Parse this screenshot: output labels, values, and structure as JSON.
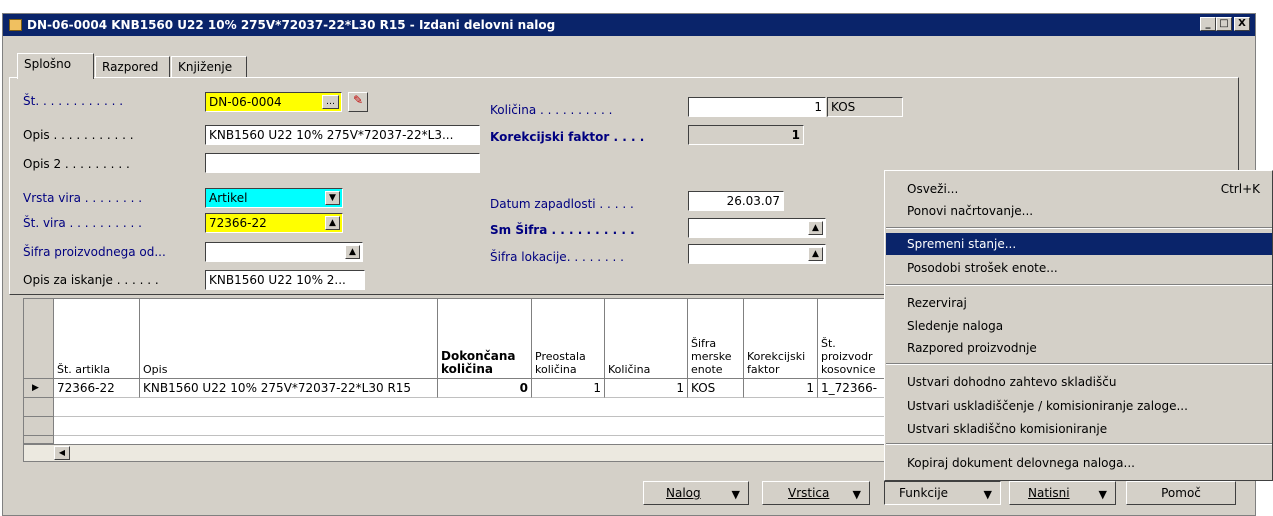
{
  "window": {
    "title": "DN-06-0004 KNB1560 U22 10% 275V*72037-22*L30 R15 - Izdani delovni nalog",
    "controls": [
      "_",
      "□",
      "X"
    ]
  },
  "tabs": [
    "Splošno",
    "Razpored",
    "Knjiženje"
  ],
  "form": {
    "st_label": "Št. . . . . . . . . . . .",
    "st_value": "DN-06-0004",
    "opis_label": "Opis . . . . . . . . . . .",
    "opis_value": "KNB1560 U22 10% 275V*72037-22*L3...",
    "opis2_label": "Opis 2 . . . . . . . . .",
    "opis2_value": "",
    "vrsta_vira_label": "Vrsta vira . . . . . . . .",
    "vrsta_vira_value": "Artikel",
    "st_vira_label": "Št. vira . . . . . . . . . .",
    "st_vira_value": "72366-22",
    "sifra_proiz_label": "Šifra proizvodnega od...",
    "sifra_proiz_value": "",
    "opis_iskanje_label": "Opis za iskanje . . . . . .",
    "opis_iskanje_value": "KNB1560 U22 10% 2...",
    "kolicina_label": "Količina . . . . . . . . . .",
    "kolicina_value": "1",
    "kolicina_unit": "KOS",
    "korekcijski_label": "Korekcijski faktor . . . .",
    "korekcijski_value": "1",
    "datum_label": "Datum zapadlosti . . . . .",
    "datum_value": "26.03.07",
    "sm_sifra_label": "Sm Šifra . . . . . . . . . .",
    "sm_sifra_value": "",
    "sifra_lok_label": "Šifra lokacije. . . . . . . .",
    "sifra_lok_value": ""
  },
  "grid": {
    "headers": {
      "st_artikla": "Št. artikla",
      "opis": "Opis",
      "dokoncana_1": "Dokončana",
      "dokoncana_2": "količina",
      "preostala_1": "Preostala",
      "preostala_2": "količina",
      "kolicina": "Količina",
      "sifra_1": "Šifra",
      "sifra_2": "merske",
      "sifra_3": "enote",
      "korek_1": "Korekcijski",
      "korek_2": "faktor",
      "stp_1": "Št.",
      "stp_2": "proizvodr",
      "stp_3": "kosovnice"
    },
    "row": {
      "st_artikla": "72366-22",
      "opis": "KNB1560 U22 10% 275V*72037-22*L30 R15",
      "dokoncana": "0",
      "preostala": "1",
      "kolicina": "1",
      "enota": "KOS",
      "korek": "1",
      "stp": "1_72366-"
    }
  },
  "buttons": {
    "nalog": "Nalog",
    "vrstica": "Vrstica",
    "funkcije": "Funkcije",
    "natisni": "Natisni",
    "pomoc": "Pomoč"
  },
  "menu": {
    "osvezi": "Osveži...",
    "osvezi_shortcut": "Ctrl+K",
    "ponovi": "Ponovi načrtovanje...",
    "spremeni": "Spremeni stanje...",
    "posodobi": "Posodobi strošek enote...",
    "rezerviraj": "Rezerviraj",
    "sledenje": "Sledenje naloga",
    "razpored": "Razpored proizvodnje",
    "ustvari_dohodno": "Ustvari dohodno zahtevo skladišču",
    "ustvari_uskladiscenje": "Ustvari uskladiščenje / komisioniranje zaloge...",
    "ustvari_skladiscno": "Ustvari skladiščno komisioniranje",
    "kopiraj": "Kopiraj dokument delovnega naloga..."
  }
}
